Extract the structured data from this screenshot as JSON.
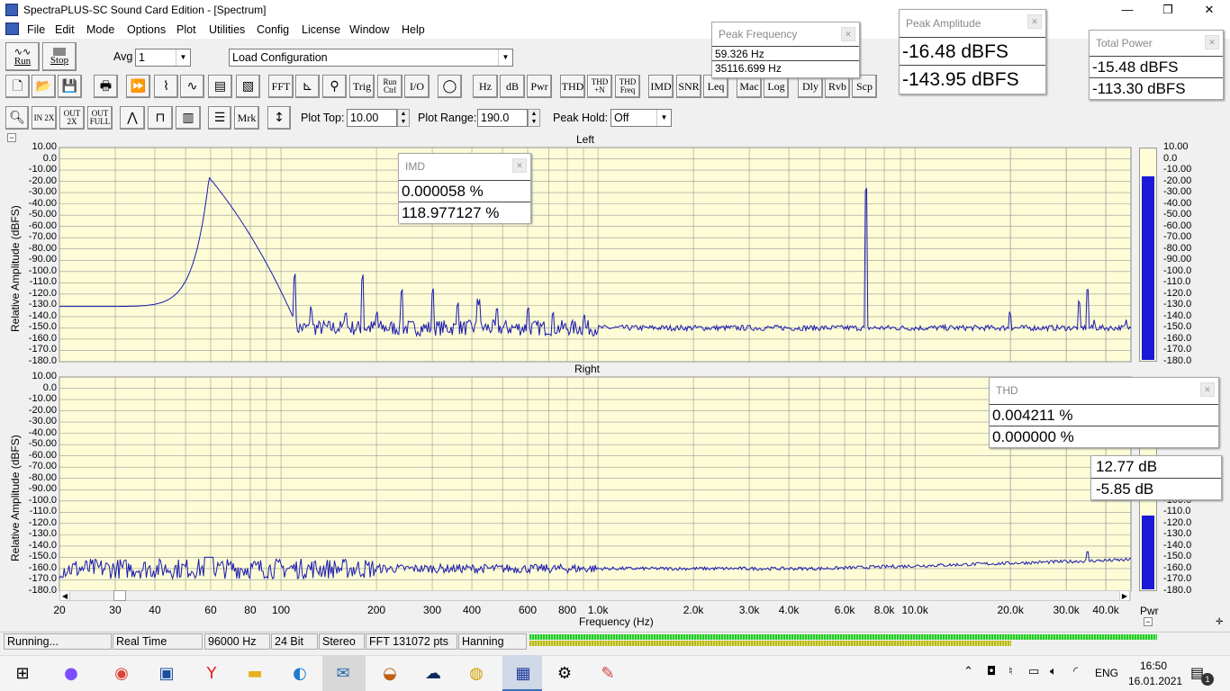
{
  "window": {
    "title": "SpectraPLUS-SC Sound Card Edition - [Spectrum]",
    "minimize": "—",
    "restore": "❐",
    "close": "✕"
  },
  "menu": [
    "File",
    "Edit",
    "Mode",
    "Options",
    "Plot",
    "Utilities",
    "Config",
    "License",
    "Window",
    "Help"
  ],
  "toolbar1": {
    "run_label": "Run",
    "stop_label": "Stop",
    "avg_label": "Avg",
    "avg_value": "1",
    "config_value": "Load Configuration"
  },
  "toolbar2": [
    "FFT",
    "Trig",
    "Run Ctrl",
    "I/O",
    "Hz",
    "dB",
    "Pwr",
    "THD",
    "THD +N",
    "THD Freq",
    "IMD",
    "SNR",
    "Leq",
    "Mac",
    "Log",
    "Dly",
    "Rvb",
    "Scp"
  ],
  "toolbar3": {
    "zoom_in": "IN 2X",
    "zoom_out": "OUT 2X",
    "zoom_full": "OUT FULL",
    "mrk": "Mrk",
    "plot_top_label": "Plot Top:",
    "plot_top_value": "10.00",
    "plot_range_label": "Plot Range:",
    "plot_range_value": "190.0",
    "peak_hold_label": "Peak Hold:",
    "peak_hold_value": "Off"
  },
  "plots": {
    "left_title": "Left",
    "right_title": "Right",
    "ylabel": "Relative Amplitude (dBFS)",
    "xlabel": "Frequency (Hz)",
    "yticks": [
      "10.00",
      "0.0",
      "-10.00",
      "-20.00",
      "-30.00",
      "-40.00",
      "-50.00",
      "-60.00",
      "-70.00",
      "-80.00",
      "-90.00",
      "-100.0",
      "-110.0",
      "-120.0",
      "-130.0",
      "-140.0",
      "-150.0",
      "-160.0",
      "-170.0",
      "-180.0"
    ],
    "xticks": [
      "20",
      "30",
      "40",
      "60",
      "80",
      "100",
      "200",
      "300",
      "400",
      "600",
      "800",
      "1.0k",
      "2.0k",
      "3.0k",
      "4.0k",
      "6.0k",
      "8.0k",
      "10.0k",
      "20.0k",
      "30.0k",
      "40.0k"
    ],
    "meter_label": "Pwr"
  },
  "meters": {
    "left_level_db": -15.48,
    "right_level_db": -113.3,
    "left_ticks": [
      "10.00",
      "0.0",
      "-10.00",
      "-20.00",
      "-30.00",
      "-40.00",
      "-50.00",
      "-60.00",
      "-70.00",
      "-80.00",
      "-90.00",
      "-100.0",
      "-110.0",
      "-120.0",
      "-130.0",
      "-140.0",
      "-150.0",
      "-160.0",
      "-170.0",
      "-180.0"
    ],
    "right_ticks": [
      "-100.0",
      "-110.0",
      "-120.0",
      "-130.0",
      "-140.0",
      "-150.0",
      "-160.0",
      "-170.0",
      "-180.0"
    ]
  },
  "readouts": {
    "peak_frequency": {
      "title": "Peak Frequency",
      "v1": "59.326 Hz",
      "v2": "35116.699 Hz"
    },
    "peak_amplitude": {
      "title": "Peak Amplitude",
      "v1": "-16.48 dBFS",
      "v2": "-143.95 dBFS"
    },
    "total_power": {
      "title": "Total Power",
      "v1": "-15.48 dBFS",
      "v2": "-113.30 dBFS"
    },
    "imd": {
      "title": "IMD",
      "v1": "0.000058 %",
      "v2": "118.977127 %"
    },
    "thd": {
      "title": "THD",
      "v1": "0.004211 %",
      "v2": "0.000000 %"
    },
    "snr": {
      "v1": "12.77 dB",
      "v2": "-5.85 dB"
    }
  },
  "status": {
    "state": "Running...",
    "mode": "Real Time",
    "rate": "96000 Hz",
    "bits": "24 Bit",
    "channels": "Stereo",
    "fft": "FFT 131072 pts",
    "window": "Hanning"
  },
  "taskbar": {
    "language": "ENG",
    "time": "16:50",
    "date": "16.01.2021",
    "notifications": "1"
  },
  "colors": {
    "trace": "#1a1ab0",
    "plot_bg": "#fdfcd6",
    "meter_bar": "#1a1ad8",
    "status_green": "#22cc22"
  }
}
